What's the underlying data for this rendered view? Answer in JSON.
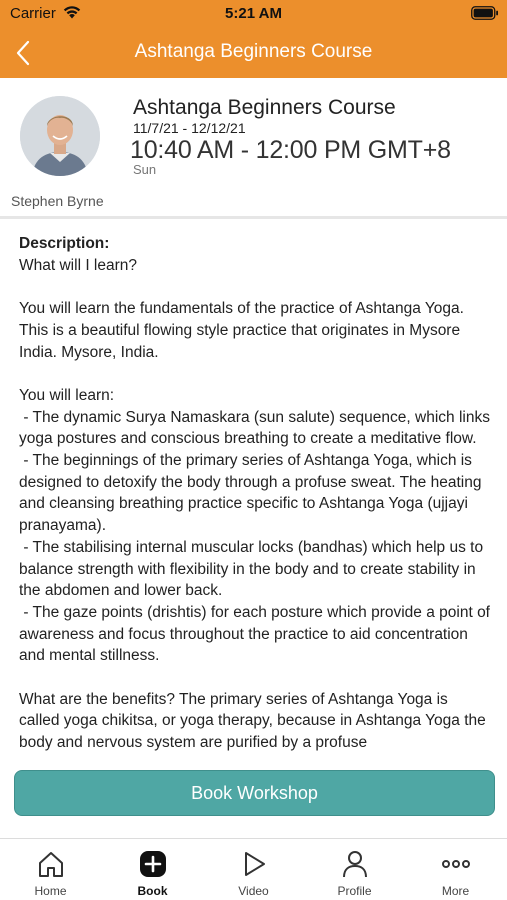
{
  "status_bar": {
    "carrier": "Carrier",
    "time": "5:21 AM"
  },
  "nav": {
    "title": "Ashtanga Beginners Course"
  },
  "header": {
    "course_title": "Ashtanga Beginners Course",
    "dates": "11/7/21 - 12/12/21",
    "time": "10:40 AM - 12:00 PM GMT+8",
    "day": "Sun",
    "instructor": "Stephen Byrne"
  },
  "description": {
    "label": "Description:",
    "text": "What will I learn?\n\nYou will learn the fundamentals of the practice of Ashtanga Yoga. This is a beautiful flowing style practice that originates in Mysore India. Mysore, India.\n\nYou will learn:\n - The dynamic Surya Namaskara (sun salute) sequence, which links yoga postures and conscious breathing to create a meditative flow.\n - The beginnings of the primary series of Ashtanga Yoga, which is designed to detoxify the body through a profuse sweat. The heating and cleansing breathing practice specific to Ashtanga Yoga (ujjayi pranayama).\n - The stabilising internal muscular locks (bandhas) which help us to balance strength with flexibility in the body and to create stability in the abdomen and lower back.\n - The gaze points (drishtis) for each posture which provide a point of awareness and focus throughout the practice to aid concentration and mental stillness.\n\nWhat are the benefits? The primary series of Ashtanga Yoga is called yoga chikitsa, or yoga therapy, because in Ashtanga Yoga the body and nervous system are purified by a profuse"
  },
  "book_button": {
    "label": "Book Workshop"
  },
  "tabs": [
    {
      "label": "Home",
      "icon": "home-icon"
    },
    {
      "label": "Book",
      "icon": "plus-square-icon"
    },
    {
      "label": "Video",
      "icon": "play-icon"
    },
    {
      "label": "Profile",
      "icon": "person-icon"
    },
    {
      "label": "More",
      "icon": "more-dots-icon"
    }
  ],
  "colors": {
    "accent": "#ec8f2c",
    "button": "#4fa7a4"
  }
}
